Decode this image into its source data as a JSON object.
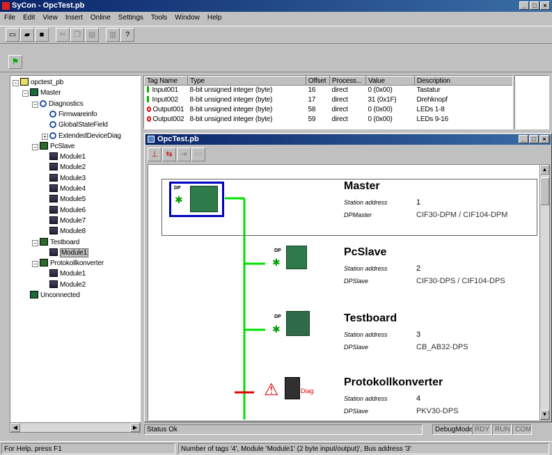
{
  "app": {
    "title": "SyCon - OpcTest.pb"
  },
  "menu": [
    "File",
    "Edit",
    "View",
    "Insert",
    "Online",
    "Settings",
    "Tools",
    "Window",
    "Help"
  ],
  "tree": {
    "items": [
      {
        "label": "opctest_pb",
        "indent": 0,
        "icon": "root",
        "pm": "-"
      },
      {
        "label": "Master",
        "indent": 1,
        "icon": "master",
        "pm": "-"
      },
      {
        "label": "Diagnostics",
        "indent": 2,
        "icon": "search",
        "pm": "-"
      },
      {
        "label": "Firmwareinfo",
        "indent": 3,
        "icon": "search",
        "pm": ""
      },
      {
        "label": "GlobalStateField",
        "indent": 3,
        "icon": "search",
        "pm": ""
      },
      {
        "label": "ExtendedDeviceDiag",
        "indent": 3,
        "icon": "search",
        "pm": "+"
      },
      {
        "label": "PcSlave",
        "indent": 2,
        "icon": "slave",
        "pm": "-"
      },
      {
        "label": "Module1",
        "indent": 3,
        "icon": "module",
        "pm": ""
      },
      {
        "label": "Module2",
        "indent": 3,
        "icon": "module",
        "pm": ""
      },
      {
        "label": "Module3",
        "indent": 3,
        "icon": "module",
        "pm": ""
      },
      {
        "label": "Module4",
        "indent": 3,
        "icon": "module",
        "pm": ""
      },
      {
        "label": "Module5",
        "indent": 3,
        "icon": "module",
        "pm": ""
      },
      {
        "label": "Module6",
        "indent": 3,
        "icon": "module",
        "pm": ""
      },
      {
        "label": "Module7",
        "indent": 3,
        "icon": "module",
        "pm": ""
      },
      {
        "label": "Module8",
        "indent": 3,
        "icon": "module",
        "pm": ""
      },
      {
        "label": "Testboard",
        "indent": 2,
        "icon": "slave",
        "pm": "-"
      },
      {
        "label": "Module1",
        "indent": 3,
        "icon": "module",
        "pm": "",
        "selected": true
      },
      {
        "label": "Protokollkonverter",
        "indent": 2,
        "icon": "slave",
        "pm": "-"
      },
      {
        "label": "Module1",
        "indent": 3,
        "icon": "module",
        "pm": ""
      },
      {
        "label": "Module2",
        "indent": 3,
        "icon": "module",
        "pm": ""
      },
      {
        "label": "Unconnected",
        "indent": 1,
        "icon": "master",
        "pm": ""
      }
    ]
  },
  "tag_table": {
    "headers": [
      "Tag Name",
      "Type",
      "Offset",
      "Process...",
      "Value",
      "Description"
    ],
    "rows": [
      {
        "marker": "input",
        "name": "Input001",
        "type": "8-bit unsigned integer (byte)",
        "offset": "16",
        "process": "direct",
        "value": "0 (0x00)",
        "desc": "Tastatur"
      },
      {
        "marker": "input",
        "name": "Input002",
        "type": "8-bit unsigned integer (byte)",
        "offset": "17",
        "process": "direct",
        "value": "31 (0x1F)",
        "desc": "Drehknopf"
      },
      {
        "marker": "output",
        "name": "Output001",
        "type": "8-bit unsigned integer (byte)",
        "offset": "58",
        "process": "direct",
        "value": "0 (0x00)",
        "desc": "LEDs 1-8"
      },
      {
        "marker": "output",
        "name": "Output002",
        "type": "8-bit unsigned integer (byte)",
        "offset": "59",
        "process": "direct",
        "value": "0 (0x00)",
        "desc": "LEDs 9-16"
      }
    ]
  },
  "child_window": {
    "title": "OpcTest.pb"
  },
  "devices": [
    {
      "name": "Master",
      "addr_label": "Station address",
      "addr": "1",
      "type_label": "DPMaster",
      "type": "CIF30-DPM / CIF104-DPM",
      "badge": "DP"
    },
    {
      "name": "PcSlave",
      "addr_label": "Station address",
      "addr": "2",
      "type_label": "DPSlave",
      "type": "CIF30-DPS / CIF104-DPS",
      "badge": "DP"
    },
    {
      "name": "Testboard",
      "addr_label": "Station address",
      "addr": "3",
      "type_label": "DPSlave",
      "type": "CB_AB32-DPS",
      "badge": "DP"
    },
    {
      "name": "Protokollkonverter",
      "addr_label": "Station address",
      "addr": "4",
      "type_label": "DPSlave",
      "type": "PKV30-DPS",
      "diag": "Diag"
    }
  ],
  "status": {
    "inner_left": "Status Ok",
    "mode": "DebugMode",
    "rdy": "RDY",
    "run": "RUN",
    "com": "COM",
    "help": "For Help, press F1",
    "bottom": "Number of tags '4', Module 'Module1' (2 byte input/output)', Bus address '3'"
  },
  "colors": {
    "bus": "#00e000",
    "error": "#e00000",
    "selection": "#0000c0"
  }
}
